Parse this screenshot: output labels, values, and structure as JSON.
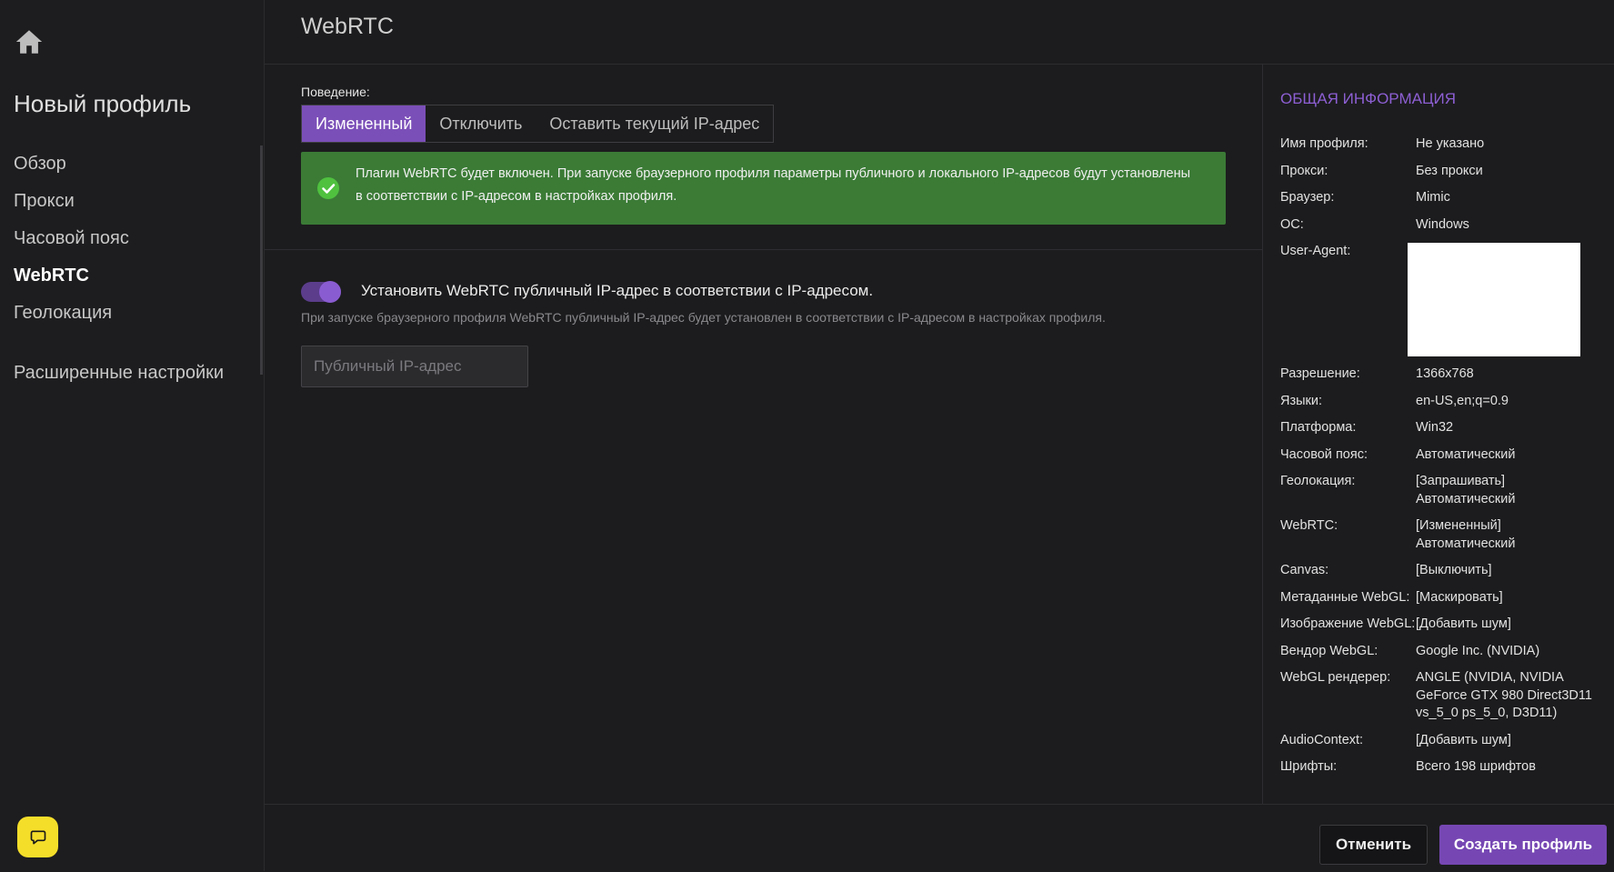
{
  "sidebar": {
    "profile_title": "Новый профиль",
    "items": [
      {
        "label": "Обзор",
        "active": false
      },
      {
        "label": "Прокси",
        "active": false
      },
      {
        "label": "Часовой пояс",
        "active": false
      },
      {
        "label": "WebRTC",
        "active": true
      },
      {
        "label": "Геолокация",
        "active": false
      }
    ],
    "advanced_label": "Расширенные настройки",
    "home_icon": "home-icon",
    "chat_icon": "chat-bubble-icon",
    "chat_color": "#f5de2a"
  },
  "header": {
    "title": "WebRTC"
  },
  "webrtc": {
    "behavior_label": "Поведение:",
    "options": [
      "Измененный",
      "Отключить",
      "Оставить текущий IP-адрес"
    ],
    "selected": "Измененный",
    "alert_text": "Плагин WebRTC будет включен. При запуске браузерного профиля параметры публичного и локального IP-адресов будут установлены в соответствии с IP-адресом в настройках профиля.",
    "alert_icon": "check-circle-icon",
    "toggle_on": true,
    "toggle_label": "Установить WebRTC публичный IP-адрес в соответствии с IP-адресом.",
    "toggle_desc": "При запуске браузерного профиля WebRTC публичный IP-адрес будет установлен в соответствии с IP-адресом в настройках профиля.",
    "ip_placeholder": "Публичный IP-адрес",
    "ip_value": ""
  },
  "info": {
    "title": "ОБЩАЯ ИНФОРМАЦИЯ",
    "rows": [
      {
        "key": "Имя профиля:",
        "value": "Не указано"
      },
      {
        "key": "Прокси:",
        "value": "Без прокси"
      },
      {
        "key": "Браузер:",
        "value": "Mimic"
      },
      {
        "key": "ОС:",
        "value": "Windows"
      },
      {
        "key": "User-Agent:",
        "value": ""
      },
      {
        "key": "Разрешение:",
        "value": "1366x768"
      },
      {
        "key": "Языки:",
        "value": "en-US,en;q=0.9"
      },
      {
        "key": "Платформа:",
        "value": "Win32"
      },
      {
        "key": "Часовой пояс:",
        "value": "Автоматический"
      },
      {
        "key": "Геолокация:",
        "value": "[Запрашивать] Автоматический"
      },
      {
        "key": "WebRTC:",
        "value": "[Измененный] Автоматический"
      },
      {
        "key": "Canvas:",
        "value": "[Выключить]"
      },
      {
        "key": "Метаданные WebGL:",
        "value": "[Маскировать]"
      },
      {
        "key": "Изображение WebGL:",
        "value": "[Добавить шум]"
      },
      {
        "key": "Вендор WebGL:",
        "value": "Google Inc. (NVIDIA)"
      },
      {
        "key": "WebGL рендерер:",
        "value": "ANGLE (NVIDIA, NVIDIA GeForce GTX 980 Direct3D11 vs_5_0 ps_5_0, D3D11)"
      },
      {
        "key": "AudioContext:",
        "value": "[Добавить шум]"
      },
      {
        "key": "Шрифты:",
        "value": "Всего 198 шрифтов"
      }
    ]
  },
  "footer": {
    "cancel_label": "Отменить",
    "create_label": "Создать профиль"
  },
  "colors": {
    "accent": "#7b4fb8",
    "success": "#3b7b36",
    "background": "#1c1c1e"
  }
}
